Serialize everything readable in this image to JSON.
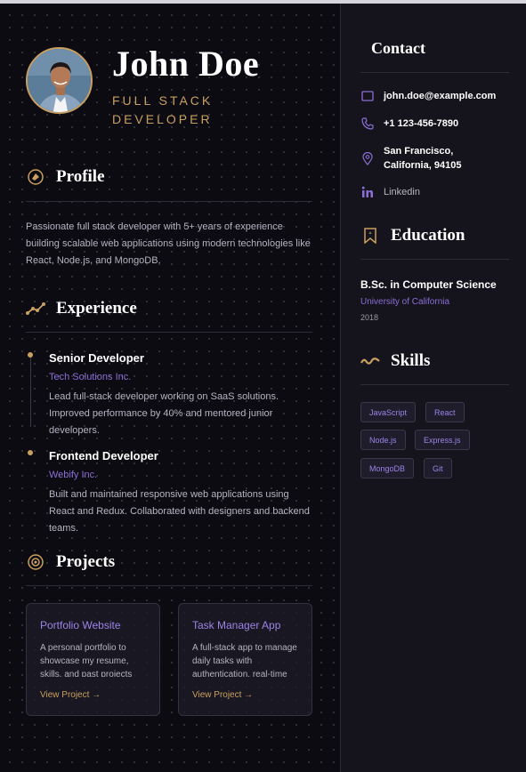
{
  "header": {
    "name": "John Doe",
    "role": "FULL STACK DEVELOPER"
  },
  "profile": {
    "heading": "Profile",
    "text": "Passionate full stack developer with 5+ years of experience building scalable web applications using modern technologies like React, Node.js, and MongoDB."
  },
  "experience": {
    "heading": "Experience",
    "jobs": [
      {
        "title": "Senior Developer",
        "company": "Tech Solutions Inc.",
        "description": "Lead full-stack developer working on SaaS solutions. Improved performance by 40% and mentored junior developers."
      },
      {
        "title": "Frontend Developer",
        "company": "Webify Inc.",
        "description": "Built and maintained responsive web applications using React and Redux. Collaborated with designers and backend teams."
      }
    ]
  },
  "projects": {
    "heading": "Projects",
    "items": [
      {
        "title": "Portfolio Website",
        "description": "A personal portfolio to showcase my resume, skills, and past projects",
        "link": "View Project →"
      },
      {
        "title": "Task Manager App",
        "description": "A full-stack app to manage daily tasks with authentication, real-time",
        "link": "View Project →"
      }
    ]
  },
  "contact": {
    "heading": "Contact",
    "email": "john.doe@example.com",
    "phone": "+1 123-456-7890",
    "location": "San Francisco, California, 94105",
    "linkedin": "Linkedin"
  },
  "education": {
    "heading": "Education",
    "degree": "B.Sc. in Computer Science",
    "school": "University of California",
    "year": "2018"
  },
  "skills": {
    "heading": "Skills",
    "items": [
      "JavaScript",
      "React",
      "Node.js",
      "Express.js",
      "MongoDB",
      "Git"
    ]
  },
  "colors": {
    "accent_gold": "#c9a061",
    "accent_purple": "#8b6fd6",
    "background": "#0c0b11",
    "sidebar": "#15141c"
  },
  "icons": {
    "profile": "user-icon",
    "experience": "chart-line-icon",
    "projects": "target-icon",
    "email": "envelope-icon",
    "phone": "phone-icon",
    "location": "map-pin-icon",
    "linkedin": "linkedin-icon",
    "education": "bookmark-icon",
    "skills": "wave-icon"
  }
}
